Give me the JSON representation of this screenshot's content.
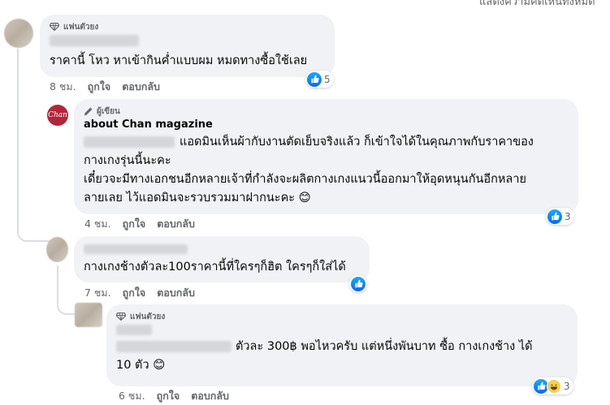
{
  "top_cut_label": "แสดงความคิดเห็นทั้งหมด",
  "comments": [
    {
      "badge": "แฟนตัวยง",
      "text": "ราคานี้ โหว หาเข้ากินค่ำแบบผม หมดทางซื้อใช้เลย",
      "time": "8 ชม.",
      "like": "ถูกใจ",
      "reply": "ตอบกลับ",
      "reaction_count": "5"
    },
    {
      "badge": "ผู้เขียน",
      "author": "about Chan magazine",
      "avatar_text": "Chan",
      "lines": [
        "แอดมินเห็นผ้ากับงานตัดเย็บจริงแล้ว ก็เข้าใจได้ในคุณภาพกับราคาของ",
        "กางเกงรุ่นนี้นะคะ",
        "เดี๋ยวจะมีทางเอกชนอีกหลายเจ้าที่กำลังจะผลิตกางเกงแนวนี้ออกมาให้อุดหนุนกันอีกหลาย",
        "ลายเลย ไว้แอดมินจะรวบรวมมาฝากนะคะ 😊"
      ],
      "time": "4 ชม.",
      "like": "ถูกใจ",
      "reply": "ตอบกลับ",
      "reaction_count": "3"
    },
    {
      "text": "กางเกงช้างตัวละ100ราคานี้ที่ใครๆก็ฮิต ใครๆก็ใส่ได้",
      "time": "7 ชม.",
      "like": "ถูกใจ",
      "reply": "ตอบกลับ"
    },
    {
      "badge": "แฟนตัวยง",
      "line1": "ตัวละ 300฿ พอไหวครับ แต่หนึ่งพันบาท ซื้อ กางเกงช้าง ได้",
      "line2": "10 ตัว 😊",
      "time": "6 ชม.",
      "like": "ถูกใจ",
      "reply": "ตอบกลับ",
      "reaction_count": "3"
    }
  ],
  "colors": {
    "bubble": "#f0f2f5",
    "meta_text": "#65676b",
    "like_blue": "#0866ff",
    "avatar_chan": "#b5253a"
  }
}
